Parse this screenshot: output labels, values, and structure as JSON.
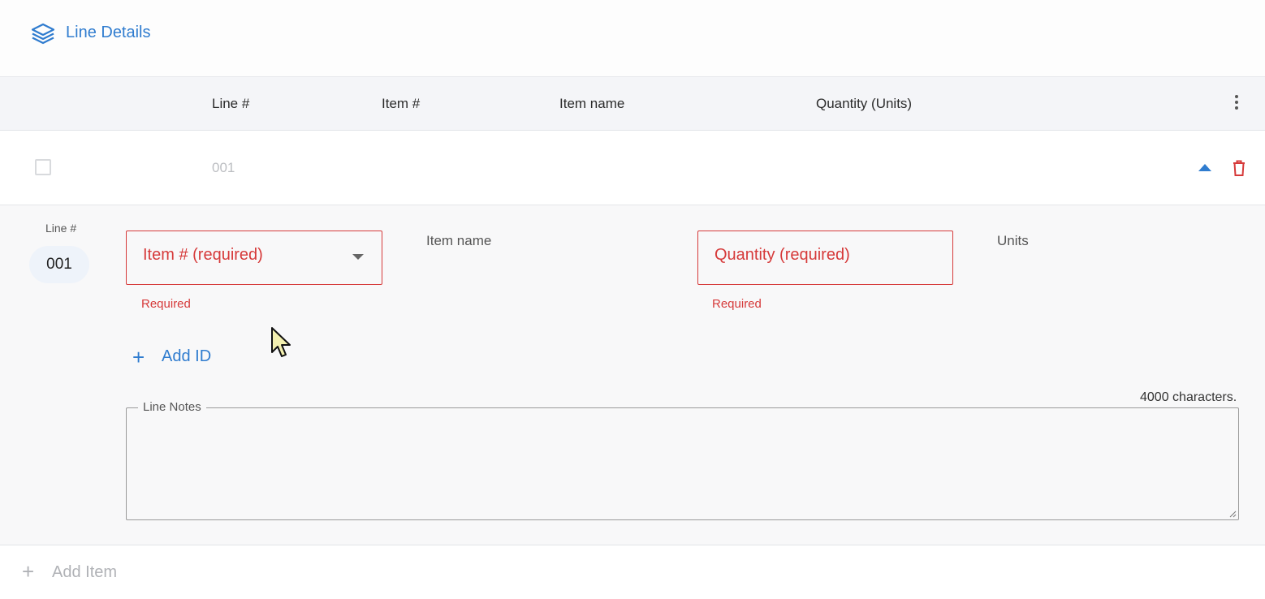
{
  "header": {
    "title": "Line Details",
    "icon": "layers-icon"
  },
  "table": {
    "columns": [
      "Line #",
      "Item #",
      "Item name",
      "Quantity (Units)"
    ],
    "rows": [
      {
        "line": "001"
      }
    ]
  },
  "detail": {
    "line_label": "Line #",
    "line_value": "001",
    "item_field": {
      "placeholder": "Item # (required)",
      "helper": "Required"
    },
    "item_name_label": "Item name",
    "quantity_field": {
      "placeholder": "Quantity (required)",
      "helper": "Required"
    },
    "units_label": "Units",
    "add_id_label": "Add ID",
    "char_counter": "4000 characters.",
    "notes_label": "Line Notes"
  },
  "footer": {
    "add_item_label": "Add Item"
  },
  "colors": {
    "accent": "#2f7ccf",
    "error": "#d63a3a",
    "disabled": "#b0b2b6"
  }
}
